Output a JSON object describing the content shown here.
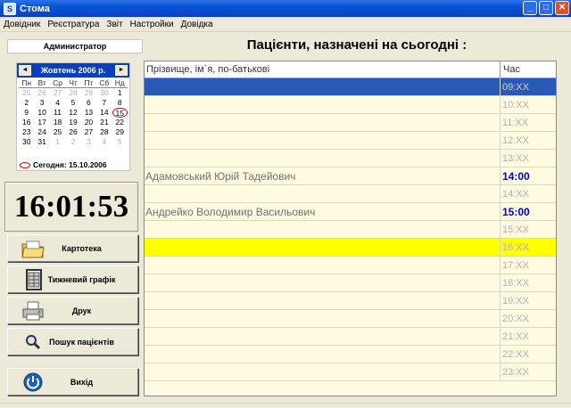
{
  "window": {
    "title": "Стома",
    "icon": "app-icon",
    "controls": [
      "_",
      "□",
      "✕"
    ]
  },
  "menu": [
    "Довідник",
    "Реєстратура",
    "Звіт",
    "Настройки",
    "Довідка"
  ],
  "user": "Администратор",
  "calendar": {
    "title": "Жовтень 2006 р.",
    "prev": "◄",
    "next": "►",
    "weekdays": [
      "Пн",
      "Вт",
      "Ср",
      "Чт",
      "Пт",
      "Сб",
      "Нд"
    ],
    "weeks": [
      [
        {
          "d": "25",
          "dim": true
        },
        {
          "d": "26",
          "dim": true
        },
        {
          "d": "27",
          "dim": true
        },
        {
          "d": "28",
          "dim": true
        },
        {
          "d": "29",
          "dim": true
        },
        {
          "d": "30",
          "dim": true
        },
        {
          "d": "1"
        }
      ],
      [
        {
          "d": "2"
        },
        {
          "d": "3"
        },
        {
          "d": "4"
        },
        {
          "d": "5"
        },
        {
          "d": "6"
        },
        {
          "d": "7"
        },
        {
          "d": "8"
        }
      ],
      [
        {
          "d": "9"
        },
        {
          "d": "10"
        },
        {
          "d": "11"
        },
        {
          "d": "12"
        },
        {
          "d": "13"
        },
        {
          "d": "14"
        },
        {
          "d": "15",
          "today": true
        }
      ],
      [
        {
          "d": "16"
        },
        {
          "d": "17"
        },
        {
          "d": "18"
        },
        {
          "d": "19"
        },
        {
          "d": "20"
        },
        {
          "d": "21"
        },
        {
          "d": "22"
        }
      ],
      [
        {
          "d": "23"
        },
        {
          "d": "24"
        },
        {
          "d": "25"
        },
        {
          "d": "26"
        },
        {
          "d": "27"
        },
        {
          "d": "28"
        },
        {
          "d": "29"
        }
      ],
      [
        {
          "d": "30"
        },
        {
          "d": "31"
        },
        {
          "d": "1",
          "dim": true
        },
        {
          "d": "2",
          "dim": true
        },
        {
          "d": "3",
          "dim": true
        },
        {
          "d": "4",
          "dim": true
        },
        {
          "d": "5",
          "dim": true
        }
      ]
    ],
    "today_label": "Сегодня: 15.10.2006"
  },
  "clock": "16:01:53",
  "nav_buttons": [
    {
      "label": "Картотека",
      "icon": "folder-icon",
      "name": "kartoteka-button"
    },
    {
      "label": "Тижневий графік",
      "icon": "calendar-sheet-icon",
      "name": "weekly-schedule-button"
    },
    {
      "label": "Друк",
      "icon": "printer-icon",
      "name": "print-button"
    },
    {
      "label": "Пошук пацієнтів",
      "icon": "magnifier-icon",
      "name": "patient-search-button"
    },
    {
      "label": "Вихід",
      "icon": "power-icon",
      "name": "exit-button"
    }
  ],
  "heading": "Пацієнти, назначені на сьогодні :",
  "table": {
    "col_name": "Прізвище, ім`я, по-батькові",
    "col_time": "Час",
    "rows": [
      {
        "name": "",
        "time": "09:XX",
        "state": "sel"
      },
      {
        "name": "",
        "time": "10:XX",
        "state": ""
      },
      {
        "name": "",
        "time": "11:XX",
        "state": ""
      },
      {
        "name": "",
        "time": "12:XX",
        "state": ""
      },
      {
        "name": "",
        "time": "13:XX",
        "state": ""
      },
      {
        "name": "Адамовський Юрій Тадейович",
        "time": "14:00",
        "state": "booked"
      },
      {
        "name": "",
        "time": "14:XX",
        "state": ""
      },
      {
        "name": "Андрейко Володимир Васильович",
        "time": "15:00",
        "state": "booked"
      },
      {
        "name": "",
        "time": "15:XX",
        "state": ""
      },
      {
        "name": "",
        "time": "16:XX",
        "state": "now"
      },
      {
        "name": "",
        "time": "17:XX",
        "state": ""
      },
      {
        "name": "",
        "time": "18:XX",
        "state": ""
      },
      {
        "name": "",
        "time": "19:XX",
        "state": ""
      },
      {
        "name": "",
        "time": "20:XX",
        "state": ""
      },
      {
        "name": "",
        "time": "21:XX",
        "state": ""
      },
      {
        "name": "",
        "time": "22:XX",
        "state": ""
      },
      {
        "name": "",
        "time": "23:XX",
        "state": ""
      }
    ]
  },
  "colors": {
    "titlebar": "#0a46c8",
    "table_bg": "#fffbe1",
    "selected_row": "#2a5ab8",
    "current_hour_row": "#ffff00",
    "booked_time": "#0000d0"
  }
}
